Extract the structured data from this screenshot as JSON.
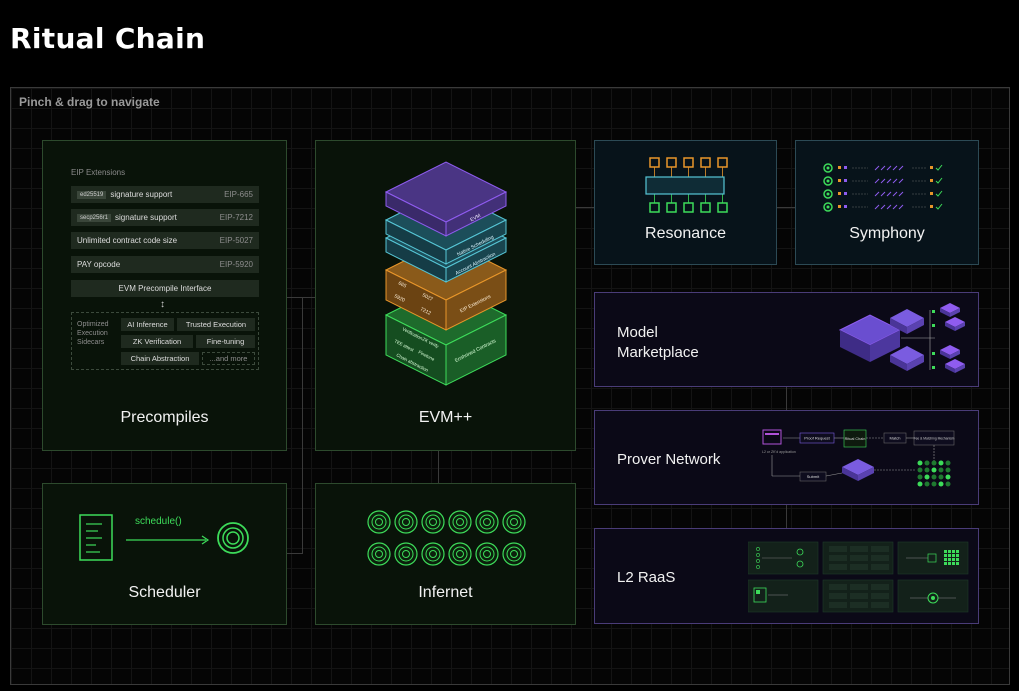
{
  "page_title": "Ritual Chain",
  "hint": "Pinch & drag to navigate",
  "precompiles": {
    "label": "Precompiles",
    "eip_header": "EIP Extensions",
    "eip_rows": [
      {
        "chip": "ed25519",
        "text": "signature support",
        "eip": "EIP-665"
      },
      {
        "chip": "secp256r1",
        "text": "signature support",
        "eip": "EIP-7212"
      },
      {
        "chip": "",
        "text": "Unlimited contract code size",
        "eip": "EIP-5027"
      },
      {
        "chip": "",
        "text": "PAY opcode",
        "eip": "EIP-5920"
      }
    ],
    "interface_label": "EVM Precompile Interface",
    "sidecars_label": "Optimized Execution Sidecars",
    "sidecars": [
      "AI Inference",
      "Trusted Execution",
      "ZK Verification",
      "Fine-tuning",
      "Chain Abstraction",
      "...and more"
    ]
  },
  "evm": {
    "label": "EVM++",
    "layers": [
      "EVM",
      "Native Scheduling",
      "Account Abstraction",
      "EIP Extensions",
      "Enshrined Contracts"
    ],
    "eip_numbers": [
      "665",
      "5027",
      "5920",
      "7212"
    ],
    "contracts": [
      "Verification",
      "ZK verify",
      "TEE attest",
      "Finetune",
      "Chain abstraction"
    ]
  },
  "scheduler": {
    "label": "Scheduler",
    "code": "schedule()"
  },
  "infernet": {
    "label": "Infernet"
  },
  "resonance": {
    "label": "Resonance"
  },
  "symphony": {
    "label": "Symphony"
  },
  "marketplace": {
    "label": "Model Marketplace"
  },
  "prover": {
    "label": "Prover Network",
    "proof_request": "Proof Request",
    "ritual_chain": "Ritual Chain",
    "match": "Match",
    "fee_market": "Fee & Matching Mechanism",
    "l2_label": "L2 or ZK’d application",
    "submit": "Submit"
  },
  "l2raas": {
    "label": "L2 RaaS"
  },
  "colors": {
    "green": "#3ddc5a",
    "orange": "#e8962a",
    "teal": "#56c6d6",
    "purple": "#8f5cf0"
  }
}
